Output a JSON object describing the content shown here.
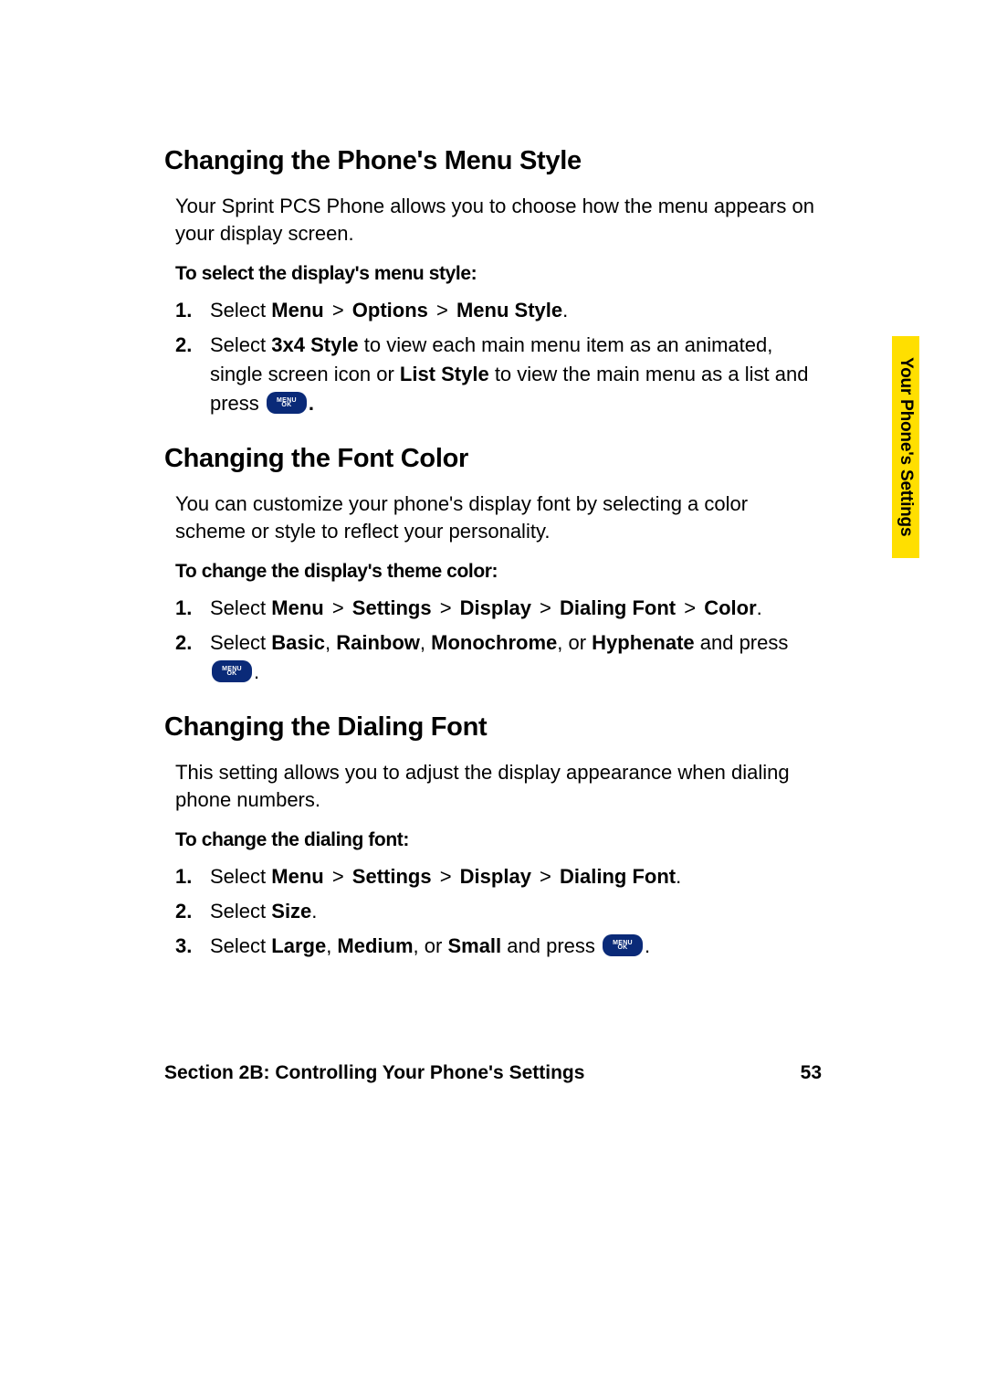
{
  "sideTab": "Your Phone's Settings",
  "footer": {
    "title": "Section 2B: Controlling Your Phone's Settings",
    "page": "53"
  },
  "button": {
    "menu": "MENU",
    "ok": "OK"
  },
  "sections": [
    {
      "heading": "Changing the Phone's Menu Style",
      "intro": "Your Sprint PCS Phone allows you to choose how the menu appears on your display screen.",
      "subheading": "To select the display's menu style:",
      "steps": [
        {
          "num": "1.",
          "parts": [
            {
              "t": "Select ",
              "b": false
            },
            {
              "t": "Menu",
              "b": true
            },
            {
              "t": " > ",
              "b": false,
              "gt": true
            },
            {
              "t": "Options",
              "b": true
            },
            {
              "t": " > ",
              "b": false,
              "gt": true
            },
            {
              "t": "Menu Style",
              "b": true
            },
            {
              "t": ".",
              "b": false
            }
          ]
        },
        {
          "num": "2.",
          "parts": [
            {
              "t": "Select ",
              "b": false
            },
            {
              "t": "3x4 Style",
              "b": true
            },
            {
              "t": " to view each main menu item as an animated, single screen icon or ",
              "b": false
            },
            {
              "t": "List Style",
              "b": true
            },
            {
              "t": " to view the main menu as a list and press ",
              "b": false
            },
            {
              "btn": true
            },
            {
              "t": ".",
              "b": true
            }
          ]
        }
      ]
    },
    {
      "heading": "Changing the Font Color",
      "intro": "You can customize your phone's display font by selecting a color scheme or style to reflect your personality.",
      "subheading": "To change the display's theme color:",
      "steps": [
        {
          "num": "1.",
          "parts": [
            {
              "t": "Select ",
              "b": false
            },
            {
              "t": "Menu",
              "b": true
            },
            {
              "t": " > ",
              "b": false,
              "gt": true
            },
            {
              "t": "Settings",
              "b": true
            },
            {
              "t": " > ",
              "b": false,
              "gt": true
            },
            {
              "t": "Display",
              "b": true
            },
            {
              "t": " > ",
              "b": false,
              "gt": true
            },
            {
              "t": "Dialing Font",
              "b": true
            },
            {
              "t": " > ",
              "b": false,
              "gt": true
            },
            {
              "t": "Color",
              "b": true
            },
            {
              "t": ".",
              "b": false
            }
          ]
        },
        {
          "num": "2.",
          "parts": [
            {
              "t": "Select ",
              "b": false
            },
            {
              "t": "Basic",
              "b": true
            },
            {
              "t": ", ",
              "b": false
            },
            {
              "t": "Rainbow",
              "b": true
            },
            {
              "t": ", ",
              "b": false
            },
            {
              "t": "Monochrome",
              "b": true
            },
            {
              "t": ", or ",
              "b": false
            },
            {
              "t": "Hyphenate",
              "b": true
            },
            {
              "t": " and press ",
              "b": false
            },
            {
              "btn": true
            },
            {
              "t": ".",
              "b": false
            }
          ]
        }
      ]
    },
    {
      "heading": "Changing the Dialing Font",
      "intro": "This setting allows you to adjust the display appearance when dialing phone numbers.",
      "subheading": "To change the dialing font:",
      "steps": [
        {
          "num": "1.",
          "parts": [
            {
              "t": "Select ",
              "b": false
            },
            {
              "t": "Menu",
              "b": true
            },
            {
              "t": " > ",
              "b": false,
              "gt": true
            },
            {
              "t": "Settings",
              "b": true
            },
            {
              "t": " > ",
              "b": false,
              "gt": true
            },
            {
              "t": "Display",
              "b": true
            },
            {
              "t": " > ",
              "b": false,
              "gt": true
            },
            {
              "t": "Dialing Font",
              "b": true
            },
            {
              "t": ".",
              "b": false
            }
          ]
        },
        {
          "num": "2.",
          "parts": [
            {
              "t": "Select ",
              "b": false
            },
            {
              "t": "Size",
              "b": true
            },
            {
              "t": ".",
              "b": false
            }
          ]
        },
        {
          "num": "3.",
          "parts": [
            {
              "t": "Select ",
              "b": false
            },
            {
              "t": "Large",
              "b": true
            },
            {
              "t": ", ",
              "b": false
            },
            {
              "t": "Medium",
              "b": true
            },
            {
              "t": ", or ",
              "b": false
            },
            {
              "t": "Small",
              "b": true
            },
            {
              "t": " and press ",
              "b": false
            },
            {
              "btn": true
            },
            {
              "t": ".",
              "b": false
            }
          ]
        }
      ]
    }
  ]
}
